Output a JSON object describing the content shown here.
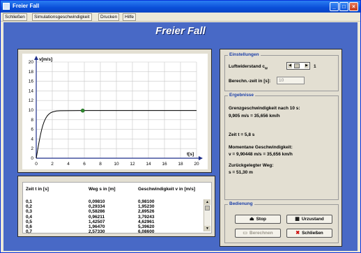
{
  "window": {
    "title": "Freier Fall"
  },
  "menu": [
    "Schließen",
    "Simulationsgeschwindigkeit",
    "Drucken",
    "Hilfe"
  ],
  "app_title": "Freier Fall",
  "chart_data": {
    "type": "line",
    "title": "",
    "xlabel": "t[s]",
    "ylabel": "v[m/s]",
    "xlim": [
      0,
      20
    ],
    "ylim": [
      0,
      20
    ],
    "x_ticks": [
      "0",
      "2",
      "4",
      "6",
      "8",
      "10",
      "12",
      "14",
      "16",
      "18",
      "20"
    ],
    "y_ticks": [
      "0",
      "2",
      "4",
      "6",
      "8",
      "10",
      "12",
      "14",
      "16",
      "18",
      "20"
    ],
    "grid": true,
    "series": [
      {
        "x": [
          0,
          0.1,
          0.2,
          0.3,
          0.4,
          0.5,
          0.6,
          0.7,
          0.8,
          1.0,
          1.2,
          1.4,
          1.6,
          1.8,
          2.0,
          2.5,
          3.0,
          5.8,
          20
        ],
        "y": [
          0,
          0.981,
          1.951,
          2.896,
          3.792,
          4.63,
          5.396,
          6.086,
          6.7,
          7.67,
          8.36,
          8.86,
          9.2,
          9.45,
          9.6,
          9.82,
          9.88,
          9.905,
          9.905
        ]
      }
    ],
    "marker": {
      "x": 5.8,
      "y": 9.905
    },
    "colors": {
      "line": "#000000",
      "marker": "#2e8b2e",
      "grid": "#c8c8c8",
      "axis": "#1f2f8a"
    }
  },
  "table": {
    "headers": [
      "Zeit t in [s]",
      "Weg s in [m]",
      "Geschwindigkeit v in [m/s]"
    ],
    "rows": [
      [
        "0,1",
        "0,09810",
        "0,98100"
      ],
      [
        "0,2",
        "0,29334",
        "1,95230"
      ],
      [
        "0,3",
        "0,58286",
        "2,89526"
      ],
      [
        "0,4",
        "0,96211",
        "3,79243"
      ],
      [
        "0,5",
        "1,42507",
        "4,62961"
      ],
      [
        "0,6",
        "1,96470",
        "5,39620"
      ],
      [
        "0,7",
        "2,57330",
        "6,08600"
      ]
    ]
  },
  "settings": {
    "group_label": "Einstellungen",
    "luftwiderstand_label": "Luftwiderstand c",
    "luftwiderstand_sub": "w",
    "luftwiderstand_value": "1",
    "berechn_label": "Berechn.-zeit in [s]:",
    "berechn_value": "10"
  },
  "results": {
    "group_label": "Ergebnisse",
    "grenz_label": "Grenzgeschwindigkeit nach 10 s:",
    "grenz_value": "9,905 m/s = 35,656 km/h",
    "zeit": "Zeit t = 5,8 s",
    "momentan_label": "Momentane Geschwindigkeit:",
    "momentan_value": "v = 9,90448 m/s = 35,656 km/h",
    "weg_label": "Zurückgelegter Weg:",
    "weg_value": "s = 51,30 m"
  },
  "controls": {
    "group_label": "Bedienung",
    "stop": "Stop",
    "urzustand": "Urzustand",
    "berechnen": "Berechnen",
    "schliessen": "Schließen"
  }
}
